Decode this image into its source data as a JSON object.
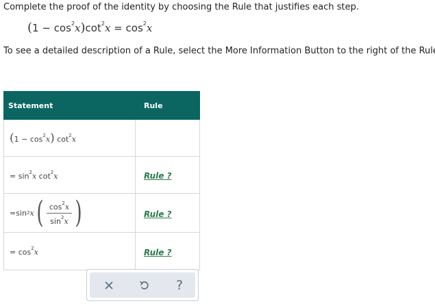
{
  "instructions": {
    "line1": "Complete the proof of the identity by choosing the Rule that justifies each step.",
    "line2": "To see a detailed description of a Rule, select the More Information Button to the right of the Rule."
  },
  "identity": {
    "open_paren": "(",
    "one_minus": "1 − ",
    "cos": "cos",
    "exp": "2",
    "x": "x",
    "close_paren": ")",
    "cot": "cot",
    "equals": " = ",
    "rhs_cos": "cos"
  },
  "table": {
    "headers": {
      "statement": "Statement",
      "rule": "Rule"
    },
    "rows": [
      {
        "statement_parts": {
          "one_minus": "1 − ",
          "cos": "cos",
          "exp": "2",
          "x": "x",
          "cot": "cot"
        },
        "rule": ""
      },
      {
        "statement_parts": {
          "eq": "= ",
          "sin": "sin",
          "exp": "2",
          "x": "x",
          "cot": "cot"
        },
        "rule": "Rule ?"
      },
      {
        "statement_parts": {
          "eq": "= ",
          "sin": "sin",
          "exp": "2",
          "x": "x",
          "num_cos": "cos",
          "den_sin": "sin"
        },
        "rule": "Rule ?"
      },
      {
        "statement_parts": {
          "eq": "= ",
          "cos": "cos",
          "exp": "2",
          "x": "x"
        },
        "rule": "Rule ?"
      }
    ]
  },
  "toolbar": {
    "clear_icon": "x-icon",
    "undo_icon": "undo-icon",
    "help_label": "?"
  },
  "colors": {
    "header_bg": "#0b6662",
    "rule_link": "#2c7a4b",
    "toolbar_bg": "#e4e8ee",
    "toolbar_icon": "#5b6a7d"
  }
}
